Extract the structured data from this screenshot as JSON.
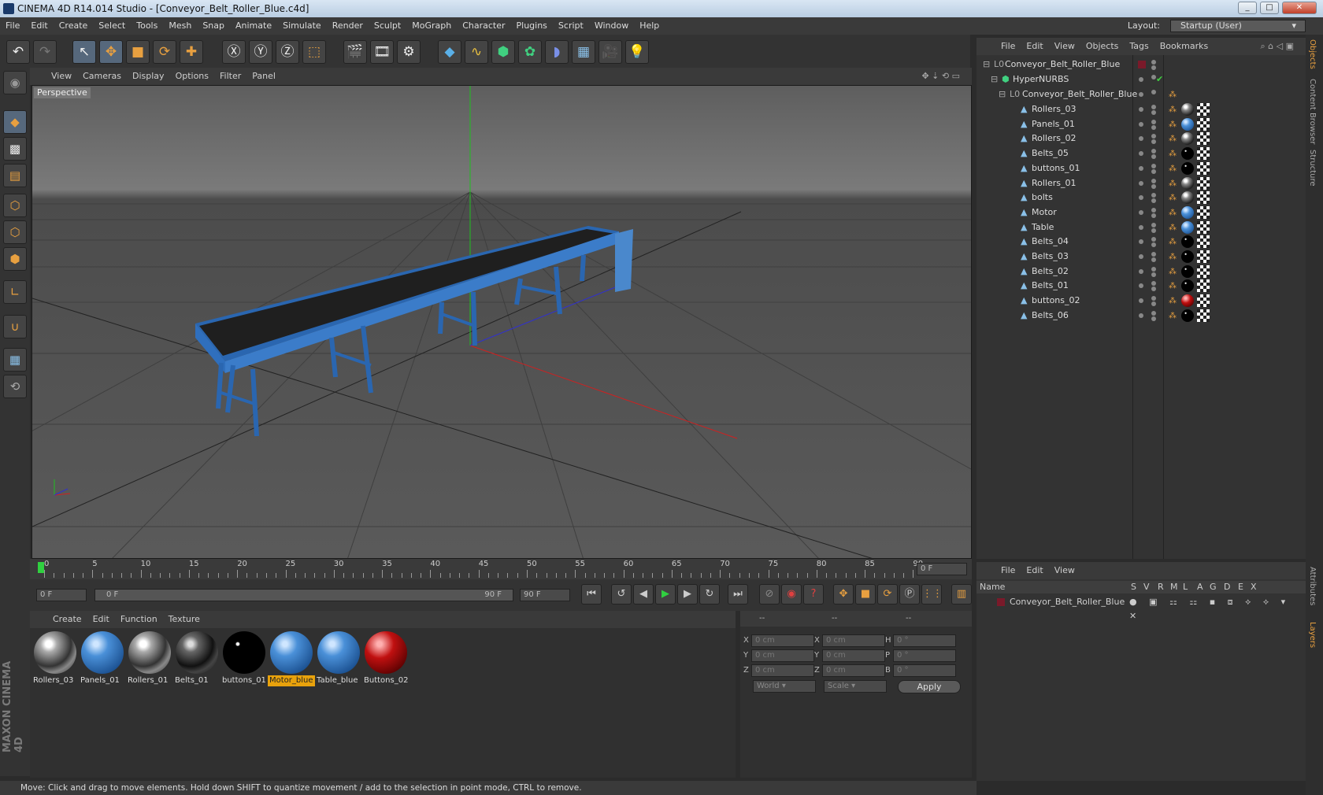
{
  "window": {
    "title": "CINEMA 4D R14.014 Studio - [Conveyor_Belt_Roller_Blue.c4d]"
  },
  "menu": [
    "File",
    "Edit",
    "Create",
    "Select",
    "Tools",
    "Mesh",
    "Snap",
    "Animate",
    "Simulate",
    "Render",
    "Sculpt",
    "MoGraph",
    "Character",
    "Plugins",
    "Script",
    "Window",
    "Help"
  ],
  "layout": {
    "label": "Layout:",
    "value": "Startup (User)"
  },
  "viewport": {
    "menu": [
      "View",
      "Cameras",
      "Display",
      "Options",
      "Filter",
      "Panel"
    ],
    "label": "Perspective"
  },
  "timeline": {
    "ticks": [
      "0",
      "5",
      "10",
      "15",
      "20",
      "25",
      "30",
      "35",
      "40",
      "45",
      "50",
      "55",
      "60",
      "65",
      "70",
      "75",
      "80",
      "85",
      "90"
    ],
    "frame_display": "0 F",
    "start": "0 F",
    "slider_left": "0 F",
    "slider_right": "90 F",
    "end": "90 F"
  },
  "materials": {
    "menu": [
      "Create",
      "Edit",
      "Function",
      "Texture"
    ],
    "items": [
      {
        "name": "Rollers_03",
        "type": "chrome"
      },
      {
        "name": "Panels_01",
        "type": "blue"
      },
      {
        "name": "Rollers_01",
        "type": "chrome"
      },
      {
        "name": "Belts_01",
        "type": "darkchrome"
      },
      {
        "name": "buttons_01",
        "type": "black"
      },
      {
        "name": "Motor_blue",
        "type": "blue",
        "selected": true
      },
      {
        "name": "Table_blue",
        "type": "blue"
      },
      {
        "name": "Buttons_02",
        "type": "red"
      }
    ]
  },
  "coords": {
    "header": [
      "--",
      "--",
      "--"
    ],
    "rows": [
      {
        "a": "X",
        "av": "0 cm",
        "b": "X",
        "bv": "0 cm",
        "c": "H",
        "cv": "0 °"
      },
      {
        "a": "Y",
        "av": "0 cm",
        "b": "Y",
        "bv": "0 cm",
        "c": "P",
        "cv": "0 °"
      },
      {
        "a": "Z",
        "av": "0 cm",
        "b": "Z",
        "bv": "0 cm",
        "c": "B",
        "cv": "0 °"
      }
    ],
    "world": "World",
    "scale": "Scale",
    "apply": "Apply"
  },
  "status": "Move: Click and drag to move elements. Hold down SHIFT to quantize movement / add to the selection in point mode, CTRL to remove.",
  "objects": {
    "menu": [
      "File",
      "Edit",
      "View",
      "Objects",
      "Tags",
      "Bookmarks"
    ],
    "root": "Conveyor_Belt_Roller_Blue",
    "hypernurbs": "HyperNURBS",
    "group": "Conveyor_Belt_Roller_Blue",
    "children": [
      {
        "name": "Rollers_03",
        "mat": "chrome"
      },
      {
        "name": "Panels_01",
        "mat": "blue"
      },
      {
        "name": "Rollers_02",
        "mat": "chrome"
      },
      {
        "name": "Belts_05",
        "mat": "black"
      },
      {
        "name": "buttons_01",
        "mat": "black"
      },
      {
        "name": "Rollers_01",
        "mat": "chrome"
      },
      {
        "name": "bolts",
        "mat": "chrome"
      },
      {
        "name": "Motor",
        "mat": "blue"
      },
      {
        "name": "Table",
        "mat": "blue"
      },
      {
        "name": "Belts_04",
        "mat": "black"
      },
      {
        "name": "Belts_03",
        "mat": "black"
      },
      {
        "name": "Belts_02",
        "mat": "black"
      },
      {
        "name": "Belts_01",
        "mat": "black"
      },
      {
        "name": "buttons_02",
        "mat": "red"
      },
      {
        "name": "Belts_06",
        "mat": "black"
      }
    ]
  },
  "layers": {
    "menu": [
      "File",
      "Edit",
      "View"
    ],
    "columns": [
      "Name",
      "S",
      "V",
      "R",
      "M",
      "L",
      "A",
      "G",
      "D",
      "E",
      "X"
    ],
    "row": "Conveyor_Belt_Roller_Blue"
  },
  "side_tabs": [
    "Objects",
    "Content Browser",
    "Structure",
    "Attributes",
    "Layers"
  ],
  "brand": "MAXON CINEMA 4D"
}
